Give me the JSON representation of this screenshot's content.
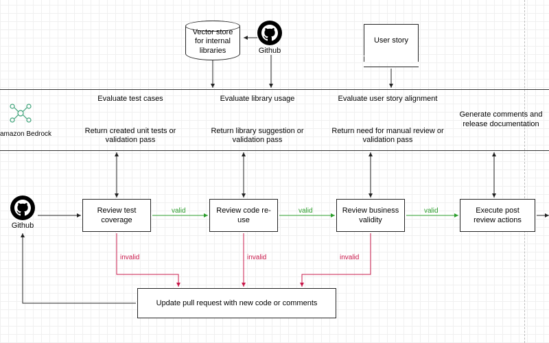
{
  "top": {
    "vector_store": "Vector store for internal libraries",
    "github_label": "Github",
    "user_story": "User story"
  },
  "bedrock_label": "amazon Bedrock",
  "band": {
    "col1_title": "Evaluate test cases",
    "col1_return": "Return created unit tests or validation pass",
    "col2_title": "Evaluate library usage",
    "col2_return": "Return library suggestion or validation pass",
    "col3_title": "Evaluate user story alignment",
    "col3_return": "Return need for manual review or validation pass",
    "col4_title": "Generate comments and release documentation"
  },
  "flow": {
    "github_label": "Github",
    "review_test": "Review test coverage",
    "review_code": "Review code re-use",
    "review_business": "Review business validity",
    "execute_post": "Execute post review actions",
    "update_pr": "Update pull request with new code or comments"
  },
  "edges": {
    "valid": "valid",
    "invalid": "invalid"
  }
}
